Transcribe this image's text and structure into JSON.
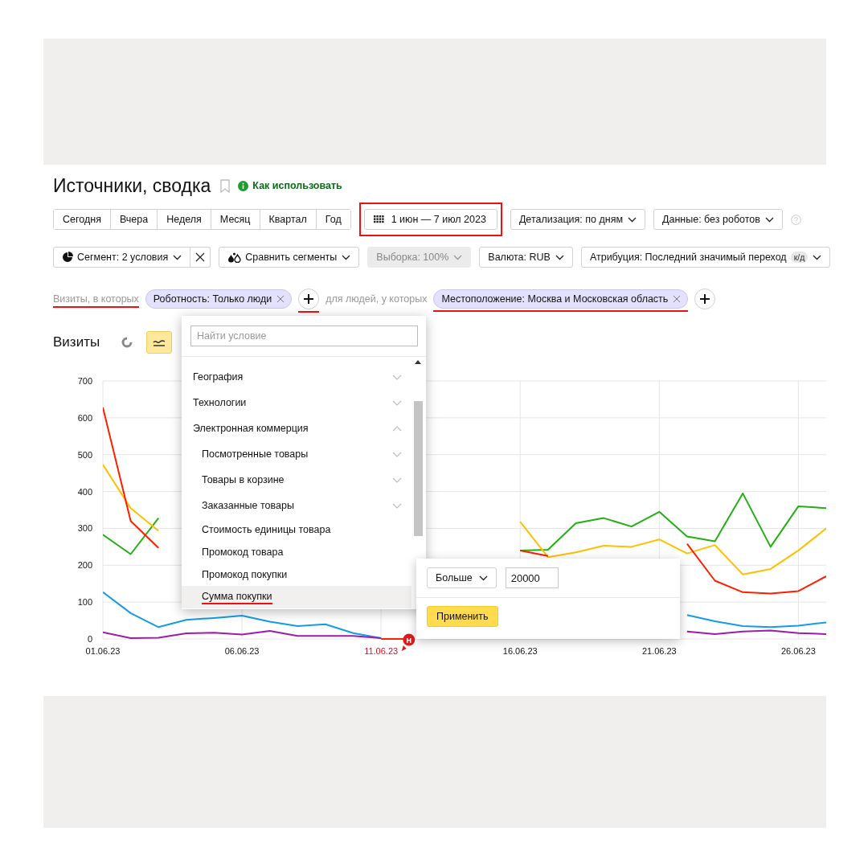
{
  "header": {
    "title": "Источники, сводка",
    "help_link": "Как использовать"
  },
  "period_buttons": [
    {
      "label": "Сегодня"
    },
    {
      "label": "Вчера"
    },
    {
      "label": "Неделя"
    },
    {
      "label": "Месяц"
    },
    {
      "label": "Квартал"
    },
    {
      "label": "Год"
    }
  ],
  "date_range": {
    "label": "1 июн — 7 июл 2023",
    "highlighted": true
  },
  "toolbar_row1": [
    {
      "label": "Детализация: по дням"
    },
    {
      "label": "Данные: без роботов"
    }
  ],
  "segment": {
    "label": "Сегмент: 2 условия"
  },
  "toolbar_row2": [
    {
      "kind": "compare",
      "label": "Сравнить сегменты",
      "disabled": false
    },
    {
      "kind": "plain",
      "label": "Выборка: 100%",
      "disabled": true
    },
    {
      "kind": "plain",
      "label": "Валюта: RUB",
      "disabled": false
    },
    {
      "kind": "badge",
      "label": "Атрибуция: Последний значимый переход",
      "badge": "к/д",
      "disabled": false
    }
  ],
  "filters": [
    {
      "kind": "text",
      "text": "Визиты, в которых",
      "underlined": true
    },
    {
      "kind": "chip",
      "text": "Роботность: Только люди",
      "underlined": false
    },
    {
      "kind": "add",
      "underlined": true
    },
    {
      "kind": "text",
      "text": "для людей, у которых",
      "underlined": false
    },
    {
      "kind": "chip",
      "text": "Местоположение: Москва и Московская область",
      "underlined": true
    },
    {
      "kind": "add",
      "underlined": false
    }
  ],
  "chart_section": {
    "title": "Визиты",
    "view_buttons": [
      {
        "kind": "pie",
        "selected": false
      },
      {
        "kind": "line",
        "selected": true
      }
    ],
    "chart_data": {
      "type": "line",
      "categories": [
        "01.06.23",
        null,
        null,
        null,
        null,
        "06.06.23",
        null,
        null,
        null,
        null,
        "11.06.23",
        null,
        null,
        null,
        null,
        "16.06.23",
        null,
        null,
        null,
        null,
        "21.06.23",
        null,
        null,
        null,
        null,
        "26.06.23",
        null
      ],
      "ylim": [
        0,
        700
      ],
      "yticks": [
        0,
        100,
        200,
        300,
        400,
        500,
        600,
        700
      ],
      "grid": true,
      "series": [
        {
          "color": "#22b014",
          "values": [
            283,
            230,
            328,
            null,
            null,
            null,
            null,
            null,
            null,
            null,
            0,
            0,
            null,
            null,
            null,
            240,
            242,
            314,
            328,
            305,
            345,
            278,
            265,
            395,
            250,
            360,
            355
          ]
        },
        {
          "color": "#ffc000",
          "values": [
            473,
            355,
            293,
            null,
            null,
            null,
            null,
            null,
            null,
            null,
            0,
            0,
            null,
            null,
            null,
            318,
            222,
            235,
            253,
            250,
            270,
            232,
            255,
            175,
            190,
            240,
            300
          ]
        },
        {
          "color": "#ff1f00",
          "values": [
            628,
            320,
            247,
            null,
            null,
            null,
            null,
            null,
            null,
            null,
            0,
            0,
            null,
            null,
            null,
            240,
            225,
            null,
            null,
            null,
            null,
            258,
            158,
            127,
            123,
            130,
            170
          ]
        },
        {
          "color": "#139ce8",
          "values": [
            127,
            70,
            32,
            52,
            57,
            63,
            47,
            35,
            40,
            16,
            2,
            null,
            null,
            null,
            null,
            null,
            null,
            null,
            null,
            null,
            null,
            65,
            48,
            35,
            32,
            36,
            45
          ]
        },
        {
          "color": "#9d1cab",
          "values": [
            18,
            2,
            3,
            15,
            17,
            12,
            22,
            8,
            8,
            8,
            2,
            null,
            null,
            null,
            null,
            null,
            null,
            null,
            null,
            null,
            null,
            20,
            13,
            20,
            23,
            16,
            13
          ]
        }
      ],
      "annotations": [
        "Н"
      ]
    },
    "holiday_ticks": [
      false,
      false,
      true,
      false,
      false,
      false
    ]
  },
  "condition_menu": {
    "search_placeholder": "Найти условие",
    "items": [
      {
        "label": "География",
        "expanded": false,
        "selected": false,
        "underlined": false
      },
      {
        "label": "Технологии",
        "expanded": false,
        "selected": false,
        "underlined": false
      },
      {
        "label": "Электронная коммерция",
        "expanded": true,
        "selected": false,
        "underlined": false,
        "children": [
          {
            "label": "Посмотренные товары",
            "kind": "group",
            "expanded": false,
            "selected": false,
            "underlined": false
          },
          {
            "label": "Товары в корзине",
            "kind": "group",
            "expanded": false,
            "selected": false,
            "underlined": false
          },
          {
            "label": "Заказанные товары",
            "kind": "group",
            "expanded": false,
            "selected": false,
            "underlined": false
          },
          {
            "label": "Стоимость единицы товара",
            "kind": "leaf",
            "selected": false,
            "underlined": false
          },
          {
            "label": "Промокод товара",
            "kind": "leaf",
            "selected": false,
            "underlined": false
          },
          {
            "label": "Промокод покупки",
            "kind": "leaf",
            "selected": false,
            "underlined": false
          },
          {
            "label": "Сумма покупки",
            "kind": "leaf",
            "selected": true,
            "underlined": true
          }
        ]
      }
    ]
  },
  "value_popover": {
    "operator": "Больше",
    "value": "20000",
    "apply": "Применить"
  }
}
